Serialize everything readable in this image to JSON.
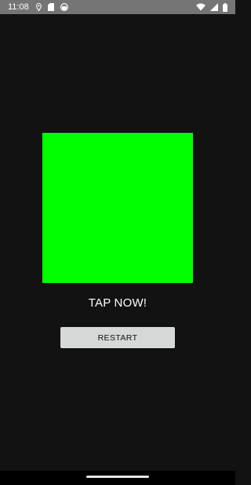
{
  "status_bar": {
    "time": "11:08",
    "icons_left": [
      "location-pin-icon",
      "sd-card-icon",
      "app-notification-icon"
    ],
    "icons_right": [
      "wifi-icon",
      "cellular-signal-icon",
      "battery-icon"
    ]
  },
  "game": {
    "target_color": "#00ff00",
    "prompt": "TAP NOW!",
    "restart_label": "RESTART"
  },
  "colors": {
    "background": "#121212",
    "status_bar": "#757575",
    "button": "#d6d7d7"
  }
}
